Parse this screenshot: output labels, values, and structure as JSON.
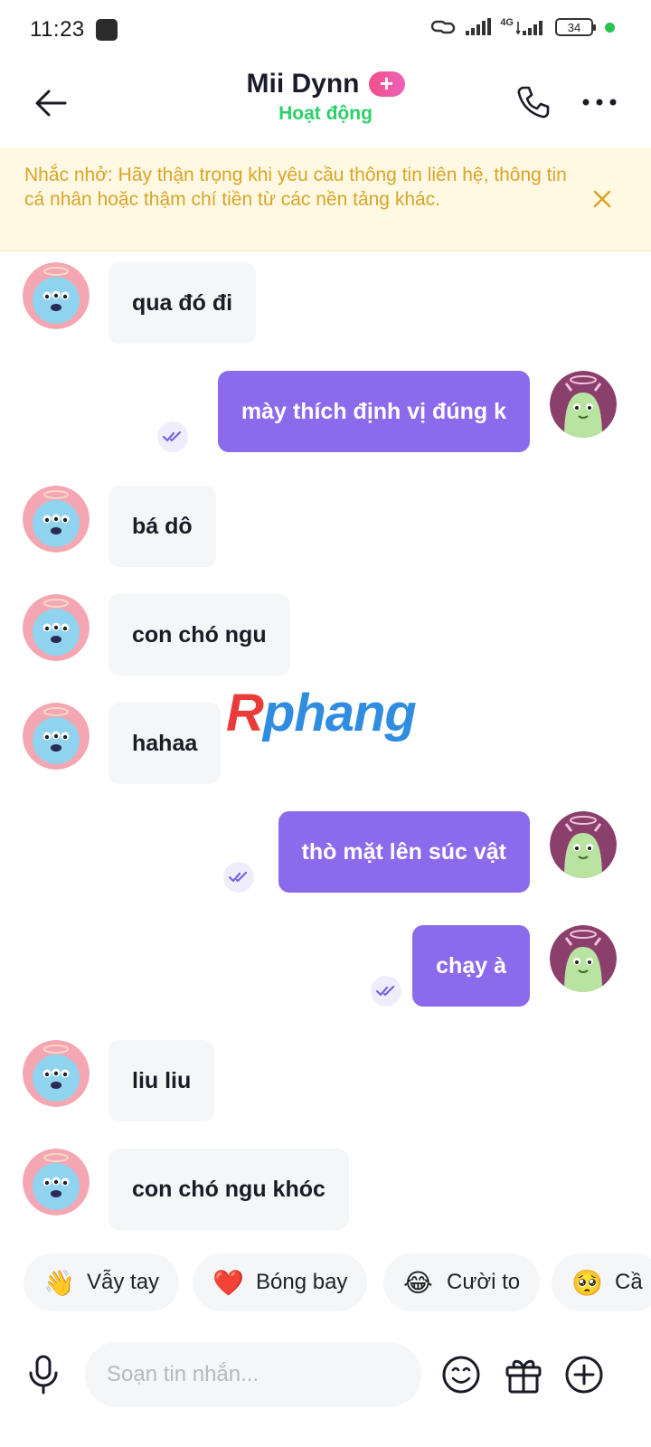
{
  "status_bar": {
    "time": "11:23",
    "network_label": "4G",
    "battery": "34"
  },
  "header": {
    "contact_name": "Mii Dynn",
    "badge": "+",
    "status": "Hoạt động"
  },
  "warning": {
    "text": "Nhắc nhở: Hãy thận trọng khi yêu cầu thông tin liên hệ, thông tin cá nhân hoặc thậm chí tiền từ các nền tảng khác."
  },
  "messages": [
    {
      "direction": "in",
      "text": "qua đó đi"
    },
    {
      "direction": "out",
      "text": "mày thích định vị đúng k",
      "read": true
    },
    {
      "direction": "in",
      "text": "bá dô"
    },
    {
      "direction": "in",
      "text": "con chó ngu"
    },
    {
      "direction": "in",
      "text": "hahaa"
    },
    {
      "direction": "out",
      "text": "thò mặt lên súc vật",
      "read": true
    },
    {
      "direction": "out",
      "text": "chạy à",
      "read": true
    },
    {
      "direction": "in",
      "text": "liu liu"
    },
    {
      "direction": "in",
      "text": "con chó ngu khóc"
    }
  ],
  "watermark": {
    "part1": "R",
    "part2": "phang"
  },
  "quick_reactions": [
    {
      "emoji": "👋",
      "label": "Vẫy tay"
    },
    {
      "emoji": "❤️",
      "label": "Bóng bay"
    },
    {
      "emoji": "😂",
      "label": "Cười to"
    },
    {
      "emoji": "🥺",
      "label": "Cầ"
    }
  ],
  "input": {
    "placeholder": "Soạn tin nhắn..."
  },
  "colors": {
    "outgoing_bubble": "#8c6aec",
    "incoming_bubble": "#f4f6f8",
    "online_status": "#2bd06a",
    "warning_text": "#d9a528",
    "warning_bg": "#fff8e2"
  }
}
